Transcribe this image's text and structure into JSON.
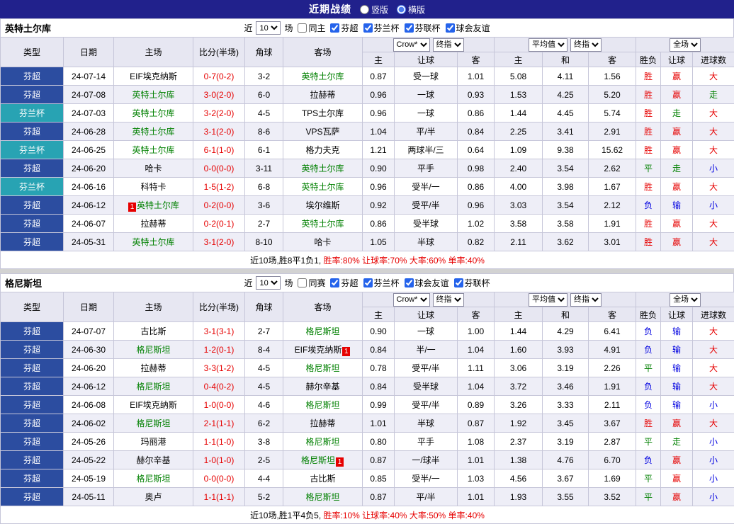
{
  "topbar": {
    "title": "近期战绩",
    "radio_vertical": "竖版",
    "radio_horizontal": "横版",
    "selected_index": 1
  },
  "colors": {
    "topbar_navy": "#21218c",
    "league_blue": "#2c4da0",
    "league_teal": "#28a3b3",
    "win_red": "#e60000",
    "draw_green": "#008000",
    "lose_blue": "#0000e0"
  },
  "sections": [
    {
      "team": "英特土尔库",
      "filter": {
        "near_label": "近",
        "count": "10",
        "matches_label": "场",
        "checkboxes": [
          {
            "label": "同主",
            "checked": false
          },
          {
            "label": "芬超",
            "checked": true
          },
          {
            "label": "芬兰杯",
            "checked": true
          },
          {
            "label": "芬联杯",
            "checked": true
          },
          {
            "label": "球会友谊",
            "checked": true
          }
        ]
      },
      "header": {
        "main_cols": [
          "类型",
          "日期",
          "主场",
          "比分(半场)",
          "角球",
          "客场"
        ],
        "groups": [
          {
            "selects": [
              "Crow*",
              "终指"
            ],
            "subs": [
              "主",
              "让球",
              "客"
            ]
          },
          {
            "selects": [
              "平均值",
              "终指"
            ],
            "subs": [
              "主",
              "和",
              "客"
            ]
          },
          {
            "selects": [
              "全场"
            ],
            "subs": [
              "胜负",
              "让球",
              "进球数"
            ]
          }
        ]
      },
      "rows": [
        {
          "league": "芬超",
          "lc": "blue",
          "date": "24-07-14",
          "home": {
            "n": "EIF埃克纳斯",
            "g": false
          },
          "score": "0-7(0-2)",
          "corner": "3-2",
          "away": {
            "n": "英特土尔库",
            "g": true
          },
          "odds": [
            "0.87",
            "受一球",
            "1.01"
          ],
          "avg": [
            "5.08",
            "4.11",
            "1.56"
          ],
          "res": [
            "胜",
            "赢",
            "大"
          ],
          "resc": [
            "r",
            "r",
            "r"
          ]
        },
        {
          "league": "芬超",
          "lc": "blue",
          "date": "24-07-08",
          "home": {
            "n": "英特土尔库",
            "g": true
          },
          "score": "3-0(2-0)",
          "corner": "6-0",
          "away": {
            "n": "拉赫蒂",
            "g": false
          },
          "odds": [
            "0.96",
            "一球",
            "0.93"
          ],
          "avg": [
            "1.53",
            "4.25",
            "5.20"
          ],
          "res": [
            "胜",
            "赢",
            "走"
          ],
          "resc": [
            "r",
            "r",
            "g"
          ]
        },
        {
          "league": "芬兰杯",
          "lc": "teal",
          "date": "24-07-03",
          "home": {
            "n": "英特土尔库",
            "g": true
          },
          "score": "3-2(2-0)",
          "corner": "4-5",
          "away": {
            "n": "TPS土尔库",
            "g": false
          },
          "odds": [
            "0.96",
            "一球",
            "0.86"
          ],
          "avg": [
            "1.44",
            "4.45",
            "5.74"
          ],
          "res": [
            "胜",
            "走",
            "大"
          ],
          "resc": [
            "r",
            "g",
            "r"
          ]
        },
        {
          "league": "芬超",
          "lc": "blue",
          "date": "24-06-28",
          "home": {
            "n": "英特土尔库",
            "g": true
          },
          "score": "3-1(2-0)",
          "corner": "8-6",
          "away": {
            "n": "VPS瓦萨",
            "g": false
          },
          "odds": [
            "1.04",
            "平/半",
            "0.84"
          ],
          "avg": [
            "2.25",
            "3.41",
            "2.91"
          ],
          "res": [
            "胜",
            "赢",
            "大"
          ],
          "resc": [
            "r",
            "r",
            "r"
          ]
        },
        {
          "league": "芬兰杯",
          "lc": "teal",
          "date": "24-06-25",
          "home": {
            "n": "英特土尔库",
            "g": true
          },
          "score": "6-1(1-0)",
          "corner": "6-1",
          "away": {
            "n": "格力夫克",
            "g": false
          },
          "odds": [
            "1.21",
            "两球半/三",
            "0.64"
          ],
          "avg": [
            "1.09",
            "9.38",
            "15.62"
          ],
          "res": [
            "胜",
            "赢",
            "大"
          ],
          "resc": [
            "r",
            "r",
            "r"
          ]
        },
        {
          "league": "芬超",
          "lc": "blue",
          "date": "24-06-20",
          "home": {
            "n": "哈卡",
            "g": false
          },
          "score": "0-0(0-0)",
          "corner": "3-11",
          "away": {
            "n": "英特土尔库",
            "g": true
          },
          "odds": [
            "0.90",
            "平手",
            "0.98"
          ],
          "avg": [
            "2.40",
            "3.54",
            "2.62"
          ],
          "res": [
            "平",
            "走",
            "小"
          ],
          "resc": [
            "g",
            "g",
            "b"
          ]
        },
        {
          "league": "芬兰杯",
          "lc": "teal",
          "date": "24-06-16",
          "home": {
            "n": "科特卡",
            "g": false
          },
          "score": "1-5(1-2)",
          "corner": "6-8",
          "away": {
            "n": "英特土尔库",
            "g": true
          },
          "odds": [
            "0.96",
            "受半/一",
            "0.86"
          ],
          "avg": [
            "4.00",
            "3.98",
            "1.67"
          ],
          "res": [
            "胜",
            "赢",
            "大"
          ],
          "resc": [
            "r",
            "r",
            "r"
          ]
        },
        {
          "league": "芬超",
          "lc": "blue",
          "date": "24-06-12",
          "home": {
            "n": "英特土尔库",
            "g": true,
            "b": "pre",
            "bt": "1"
          },
          "score": "0-2(0-0)",
          "corner": "3-6",
          "away": {
            "n": "埃尔维斯",
            "g": false
          },
          "odds": [
            "0.92",
            "受平/半",
            "0.96"
          ],
          "avg": [
            "3.03",
            "3.54",
            "2.12"
          ],
          "res": [
            "负",
            "输",
            "小"
          ],
          "resc": [
            "b",
            "b",
            "b"
          ]
        },
        {
          "league": "芬超",
          "lc": "blue",
          "date": "24-06-07",
          "home": {
            "n": "拉赫蒂",
            "g": false
          },
          "score": "0-2(0-1)",
          "corner": "2-7",
          "away": {
            "n": "英特土尔库",
            "g": true
          },
          "odds": [
            "0.86",
            "受半球",
            "1.02"
          ],
          "avg": [
            "3.58",
            "3.58",
            "1.91"
          ],
          "res": [
            "胜",
            "赢",
            "大"
          ],
          "resc": [
            "r",
            "r",
            "r"
          ]
        },
        {
          "league": "芬超",
          "lc": "blue",
          "date": "24-05-31",
          "home": {
            "n": "英特土尔库",
            "g": true
          },
          "score": "3-1(2-0)",
          "corner": "8-10",
          "away": {
            "n": "哈卡",
            "g": false
          },
          "odds": [
            "1.05",
            "半球",
            "0.82"
          ],
          "avg": [
            "2.11",
            "3.62",
            "3.01"
          ],
          "res": [
            "胜",
            "赢",
            "大"
          ],
          "resc": [
            "r",
            "r",
            "r"
          ]
        }
      ],
      "summary": {
        "prefix": "近10场,胜8平1负1, ",
        "stats": "胜率:80% 让球率:70% 大率:60% 单率:40%"
      }
    },
    {
      "team": "格尼斯坦",
      "filter": {
        "near_label": "近",
        "count": "10",
        "matches_label": "场",
        "checkboxes": [
          {
            "label": "同赛",
            "checked": false
          },
          {
            "label": "芬超",
            "checked": true
          },
          {
            "label": "芬兰杯",
            "checked": true
          },
          {
            "label": "球会友谊",
            "checked": true
          },
          {
            "label": "芬联杯",
            "checked": true
          }
        ]
      },
      "header": {
        "main_cols": [
          "类型",
          "日期",
          "主场",
          "比分(半场)",
          "角球",
          "客场"
        ],
        "groups": [
          {
            "selects": [
              "Crow*",
              "终指"
            ],
            "subs": [
              "主",
              "让球",
              "客"
            ]
          },
          {
            "selects": [
              "平均值",
              "终指"
            ],
            "subs": [
              "主",
              "和",
              "客"
            ]
          },
          {
            "selects": [
              "全场"
            ],
            "subs": [
              "胜负",
              "让球",
              "进球数"
            ]
          }
        ]
      },
      "rows": [
        {
          "league": "芬超",
          "lc": "blue",
          "date": "24-07-07",
          "home": {
            "n": "古比斯",
            "g": false
          },
          "score": "3-1(3-1)",
          "corner": "2-7",
          "away": {
            "n": "格尼斯坦",
            "g": true
          },
          "odds": [
            "0.90",
            "一球",
            "1.00"
          ],
          "avg": [
            "1.44",
            "4.29",
            "6.41"
          ],
          "res": [
            "负",
            "输",
            "大"
          ],
          "resc": [
            "b",
            "b",
            "r"
          ]
        },
        {
          "league": "芬超",
          "lc": "blue",
          "date": "24-06-30",
          "home": {
            "n": "格尼斯坦",
            "g": true
          },
          "score": "1-2(0-1)",
          "corner": "8-4",
          "away": {
            "n": "EIF埃克纳斯",
            "g": false,
            "b": "post",
            "bt": "1"
          },
          "odds": [
            "0.84",
            "半/一",
            "1.04"
          ],
          "avg": [
            "1.60",
            "3.93",
            "4.91"
          ],
          "res": [
            "负",
            "输",
            "大"
          ],
          "resc": [
            "b",
            "b",
            "r"
          ]
        },
        {
          "league": "芬超",
          "lc": "blue",
          "date": "24-06-20",
          "home": {
            "n": "拉赫蒂",
            "g": false
          },
          "score": "3-3(1-2)",
          "corner": "4-5",
          "away": {
            "n": "格尼斯坦",
            "g": true
          },
          "odds": [
            "0.78",
            "受平/半",
            "1.11"
          ],
          "avg": [
            "3.06",
            "3.19",
            "2.26"
          ],
          "res": [
            "平",
            "输",
            "大"
          ],
          "resc": [
            "g",
            "b",
            "r"
          ]
        },
        {
          "league": "芬超",
          "lc": "blue",
          "date": "24-06-12",
          "home": {
            "n": "格尼斯坦",
            "g": true
          },
          "score": "0-4(0-2)",
          "corner": "4-5",
          "away": {
            "n": "赫尔辛基",
            "g": false
          },
          "odds": [
            "0.84",
            "受半球",
            "1.04"
          ],
          "avg": [
            "3.72",
            "3.46",
            "1.91"
          ],
          "res": [
            "负",
            "输",
            "大"
          ],
          "resc": [
            "b",
            "b",
            "r"
          ]
        },
        {
          "league": "芬超",
          "lc": "blue",
          "date": "24-06-08",
          "home": {
            "n": "EIF埃克纳斯",
            "g": false
          },
          "score": "1-0(0-0)",
          "corner": "4-6",
          "away": {
            "n": "格尼斯坦",
            "g": true
          },
          "odds": [
            "0.99",
            "受平/半",
            "0.89"
          ],
          "avg": [
            "3.26",
            "3.33",
            "2.11"
          ],
          "res": [
            "负",
            "输",
            "小"
          ],
          "resc": [
            "b",
            "b",
            "b"
          ]
        },
        {
          "league": "芬超",
          "lc": "blue",
          "date": "24-06-02",
          "home": {
            "n": "格尼斯坦",
            "g": true
          },
          "score": "2-1(1-1)",
          "corner": "6-2",
          "away": {
            "n": "拉赫蒂",
            "g": false
          },
          "odds": [
            "1.01",
            "半球",
            "0.87"
          ],
          "avg": [
            "1.92",
            "3.45",
            "3.67"
          ],
          "res": [
            "胜",
            "赢",
            "大"
          ],
          "resc": [
            "r",
            "r",
            "r"
          ]
        },
        {
          "league": "芬超",
          "lc": "blue",
          "date": "24-05-26",
          "home": {
            "n": "玛丽港",
            "g": false
          },
          "score": "1-1(1-0)",
          "corner": "3-8",
          "away": {
            "n": "格尼斯坦",
            "g": true
          },
          "odds": [
            "0.80",
            "平手",
            "1.08"
          ],
          "avg": [
            "2.37",
            "3.19",
            "2.87"
          ],
          "res": [
            "平",
            "走",
            "小"
          ],
          "resc": [
            "g",
            "g",
            "b"
          ]
        },
        {
          "league": "芬超",
          "lc": "blue",
          "date": "24-05-22",
          "home": {
            "n": "赫尔辛基",
            "g": false
          },
          "score": "1-0(1-0)",
          "corner": "2-5",
          "away": {
            "n": "格尼斯坦",
            "g": true,
            "b": "post",
            "bt": "1"
          },
          "odds": [
            "0.87",
            "一/球半",
            "1.01"
          ],
          "avg": [
            "1.38",
            "4.76",
            "6.70"
          ],
          "res": [
            "负",
            "赢",
            "小"
          ],
          "resc": [
            "b",
            "r",
            "b"
          ]
        },
        {
          "league": "芬超",
          "lc": "blue",
          "date": "24-05-19",
          "home": {
            "n": "格尼斯坦",
            "g": true
          },
          "score": "0-0(0-0)",
          "corner": "4-4",
          "away": {
            "n": "古比斯",
            "g": false
          },
          "odds": [
            "0.85",
            "受半/一",
            "1.03"
          ],
          "avg": [
            "4.56",
            "3.67",
            "1.69"
          ],
          "res": [
            "平",
            "赢",
            "小"
          ],
          "resc": [
            "g",
            "r",
            "b"
          ]
        },
        {
          "league": "芬超",
          "lc": "blue",
          "date": "24-05-11",
          "home": {
            "n": "奥卢",
            "g": false
          },
          "score": "1-1(1-1)",
          "corner": "5-2",
          "away": {
            "n": "格尼斯坦",
            "g": true
          },
          "odds": [
            "0.87",
            "平/半",
            "1.01"
          ],
          "avg": [
            "1.93",
            "3.55",
            "3.52"
          ],
          "res": [
            "平",
            "赢",
            "小"
          ],
          "resc": [
            "g",
            "r",
            "b"
          ]
        }
      ],
      "summary": {
        "prefix": "近10场,胜1平4负5, ",
        "stats": "胜率:10% 让球率:40% 大率:50% 单率:40%"
      }
    }
  ]
}
